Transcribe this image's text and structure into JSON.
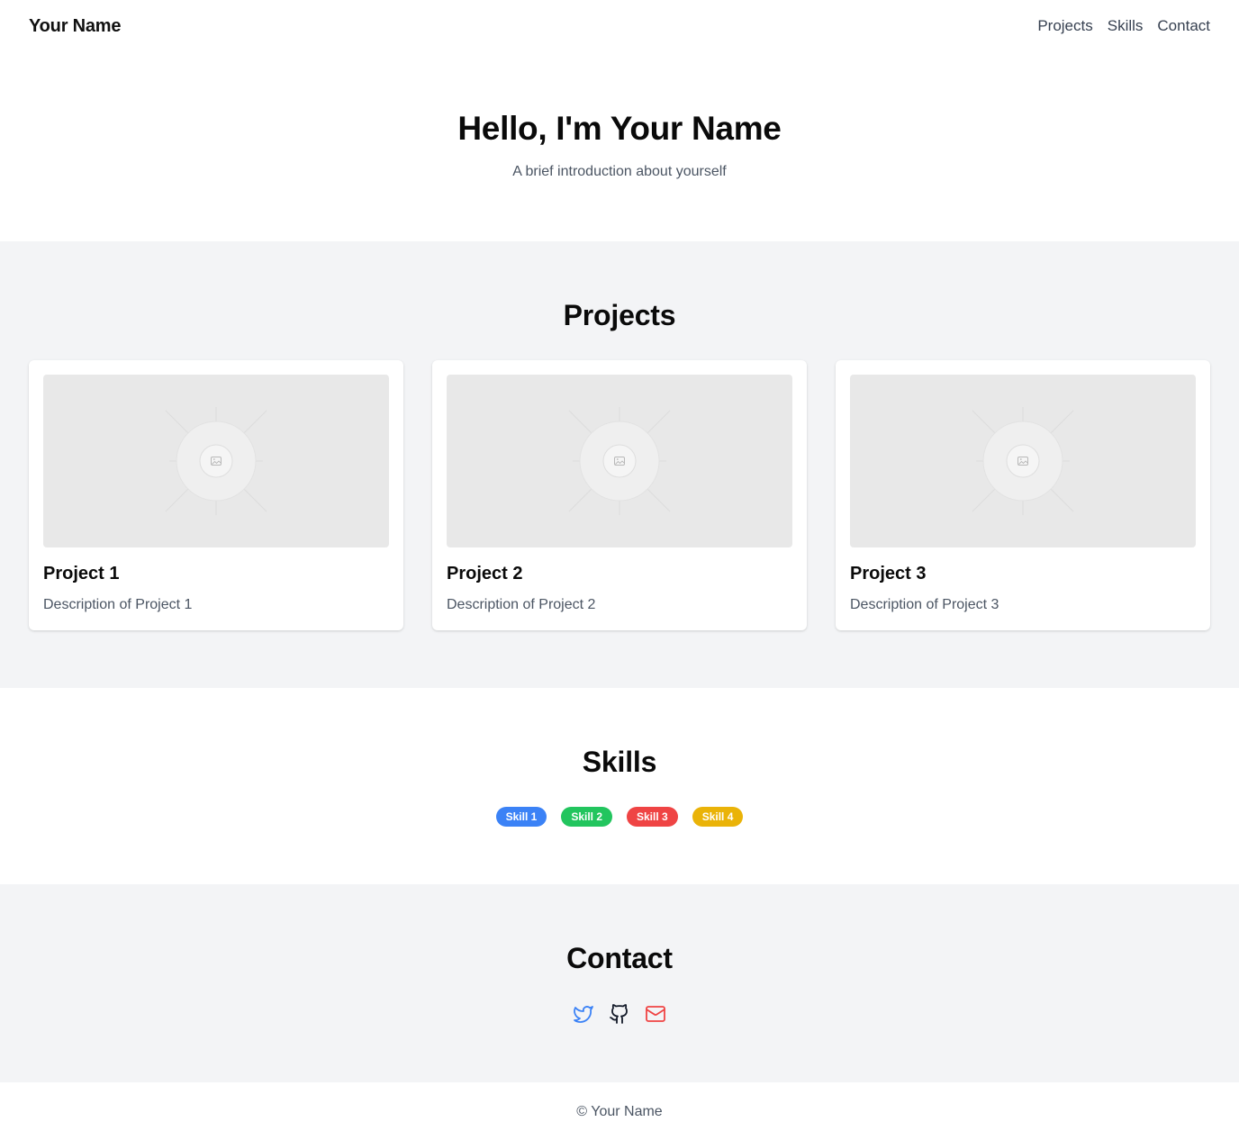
{
  "header": {
    "brand": "Your Name",
    "nav": [
      {
        "label": "Projects"
      },
      {
        "label": "Skills"
      },
      {
        "label": "Contact"
      }
    ]
  },
  "hero": {
    "title": "Hello, I'm Your Name",
    "subtitle": "A brief introduction about yourself"
  },
  "projects": {
    "title": "Projects",
    "items": [
      {
        "title": "Project 1",
        "description": "Description of Project 1",
        "image_icon": "image-placeholder-icon"
      },
      {
        "title": "Project 2",
        "description": "Description of Project 2",
        "image_icon": "image-placeholder-icon"
      },
      {
        "title": "Project 3",
        "description": "Description of Project 3",
        "image_icon": "image-placeholder-icon"
      }
    ]
  },
  "skills": {
    "title": "Skills",
    "items": [
      {
        "label": "Skill 1",
        "color": "#3b82f6"
      },
      {
        "label": "Skill 2",
        "color": "#22c55e"
      },
      {
        "label": "Skill 3",
        "color": "#ef4444"
      },
      {
        "label": "Skill 4",
        "color": "#eab308"
      }
    ]
  },
  "contact": {
    "title": "Contact",
    "links": [
      {
        "icon": "twitter-icon",
        "color": "#3b82f6"
      },
      {
        "icon": "github-icon",
        "color": "#111827"
      },
      {
        "icon": "mail-icon",
        "color": "#ef4444"
      }
    ]
  },
  "footer": {
    "text": "© Your Name"
  }
}
